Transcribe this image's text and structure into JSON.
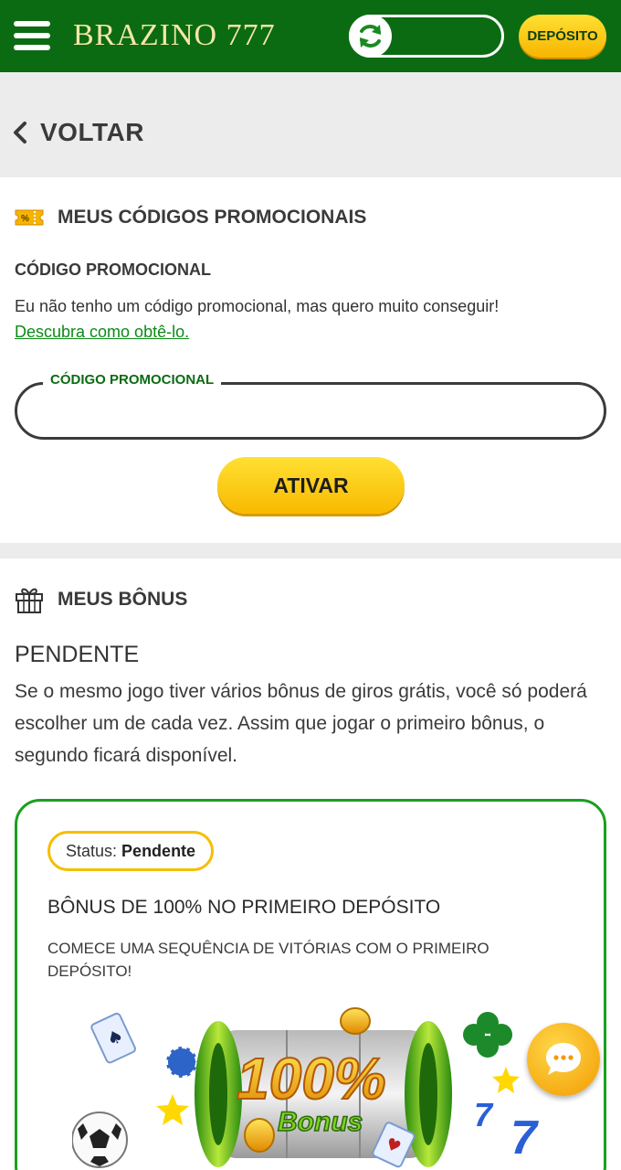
{
  "header": {
    "logo_text": "BRAZINO 777",
    "deposit_label": "DEPÓSITO",
    "menu_icon": "hamburger-menu-icon",
    "refresh_icon": "refresh-icon"
  },
  "back": {
    "label": "VOLTAR",
    "icon": "chevron-left-icon"
  },
  "promo": {
    "section_title": "MEUS CÓDIGOS PROMOCIONAIS",
    "section_icon": "ticket-icon",
    "subtitle": "CÓDIGO PROMOCIONAL",
    "description": "Eu não tenho um código promocional, mas quero muito conseguir!",
    "link_label": "Descubra como obtê-lo.",
    "field_label": "CÓDIGO PROMOCIONAL",
    "field_value": "",
    "activate_label": "ATIVAR"
  },
  "bonus": {
    "section_title": "MEUS BÔNUS",
    "section_icon": "gift-icon",
    "pending_title": "PENDENTE",
    "pending_description": "Se o mesmo jogo tiver vários bônus de giros grátis, você só poderá escolher um de cada vez. Assim que jogar o primeiro bônus, o segundo ficará disponível.",
    "card": {
      "status_label": "Status:",
      "status_value": "Pendente",
      "title": "BÔNUS DE 100% NO PRIMEIRO DEPÓSITO",
      "description": "COMECE UMA SEQUÊNCIA DE VITÓRIAS COM O PRIMEIRO DEPÓSITO!",
      "banner_text_big": "100%",
      "banner_text_small": "Bonus"
    }
  },
  "chat": {
    "icon": "chat-bubble-icon"
  },
  "colors": {
    "brand_green": "#0b6b12",
    "accent_yellow": "#f7b500",
    "link_green": "#0b8a16",
    "card_border": "#1aa01e"
  }
}
